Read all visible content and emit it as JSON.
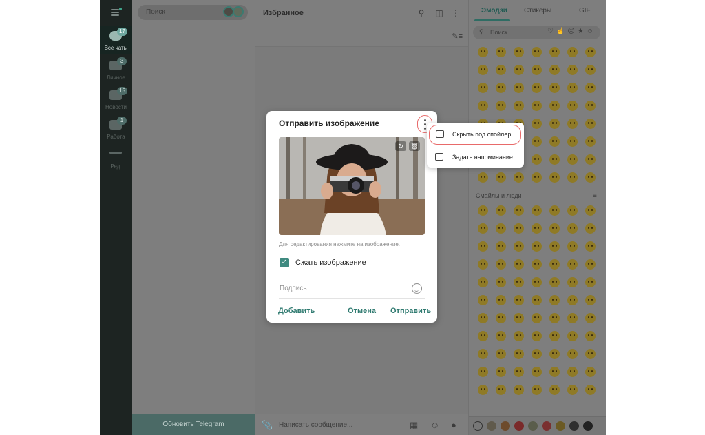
{
  "folders": {
    "items": [
      {
        "label": "Все чаты",
        "badge": "17"
      },
      {
        "label": "Личное",
        "badge": "3"
      },
      {
        "label": "Новости",
        "badge": "15"
      },
      {
        "label": "Работа",
        "badge": "1"
      },
      {
        "label": "Ред.",
        "badge": ""
      }
    ]
  },
  "chatlist": {
    "search_placeholder": "Поиск",
    "update_button": "Обновить Telegram"
  },
  "conversation": {
    "title": "Избранное",
    "composer_placeholder": "Написать сообщение..."
  },
  "emoji_panel": {
    "tabs": [
      "Эмодзи",
      "Стикеры",
      "GIF"
    ],
    "search_placeholder": "Поиск",
    "section_title": "Смайлы и люди"
  },
  "modal": {
    "title": "Отправить изображение",
    "hint": "Для редактирования нажмите на изображение.",
    "compress_label": "Сжать изображение",
    "caption_placeholder": "Подпись",
    "add_label": "Добавить",
    "cancel_label": "Отмена",
    "send_label": "Отправить"
  },
  "context_menu": {
    "items": [
      {
        "label": "Скрыть под спойлер"
      },
      {
        "label": "Задать напоминание"
      }
    ]
  },
  "colors": {
    "accent": "#3f8a80",
    "highlight_ring": "#e86a6a",
    "overlay_dark": "#1d2422"
  }
}
